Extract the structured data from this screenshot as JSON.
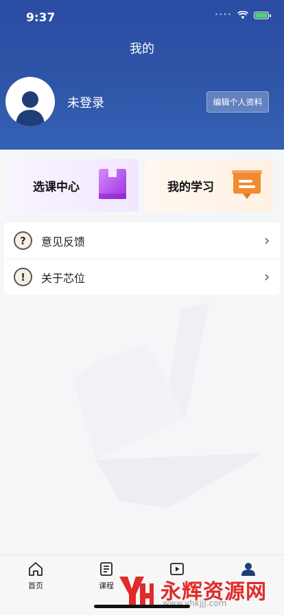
{
  "status": {
    "time": "9:37",
    "signal": "••••"
  },
  "header": {
    "title": "我的",
    "username": "未登录",
    "edit_label": "编辑个人资料"
  },
  "cards": [
    {
      "label": "选课中心",
      "icon": "course-box-icon",
      "color": "#b44cf0"
    },
    {
      "label": "我的学习",
      "icon": "study-board-icon",
      "color": "#f28a2e"
    }
  ],
  "menu": [
    {
      "label": "意见反馈",
      "icon": "question-icon",
      "glyph": "?"
    },
    {
      "label": "关于芯位",
      "icon": "info-icon",
      "glyph": "!"
    }
  ],
  "tabs": [
    {
      "label": "首页",
      "icon": "home-icon"
    },
    {
      "label": "课程",
      "icon": "document-icon"
    },
    {
      "label": "",
      "icon": "play-icon"
    },
    {
      "label": "",
      "icon": "profile-icon"
    }
  ],
  "brand": {
    "name": "永辉资源网",
    "url": "www.yhkjjj.com"
  },
  "colors": {
    "header": "#2f55a8",
    "accent_red": "#e02b2b"
  }
}
